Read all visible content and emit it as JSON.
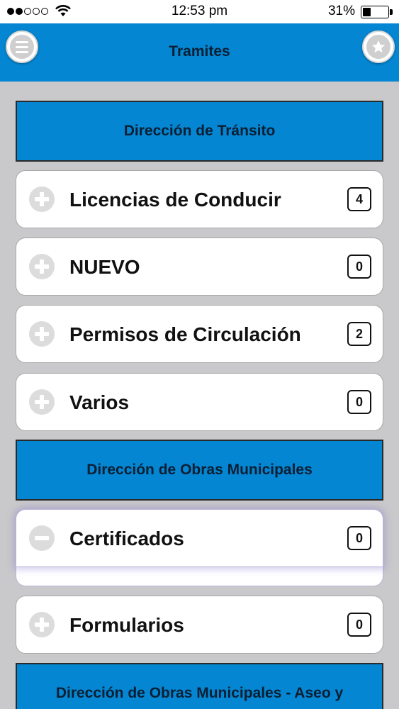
{
  "status_bar": {
    "time": "12:53 pm",
    "battery": "31%",
    "battery_level": 0.31,
    "signal_dots_filled": 2,
    "signal_dots_total": 5
  },
  "nav": {
    "title": "Tramites",
    "menu_icon": "hamburger-menu-icon",
    "favorite_icon": "star-icon"
  },
  "colors": {
    "accent": "#0586d2",
    "background": "#c9c9cb",
    "card": "#ffffff"
  },
  "sections": [
    {
      "title": "Dirección de Tránsito",
      "items": [
        {
          "label": "Licencias de Conducir",
          "count": "4",
          "state": "collapsed",
          "icon": "plus-icon"
        },
        {
          "label": "NUEVO",
          "count": "0",
          "state": "collapsed",
          "icon": "plus-icon"
        },
        {
          "label": "Permisos de Circulación",
          "count": "2",
          "state": "collapsed",
          "icon": "plus-icon"
        },
        {
          "label": "Varios",
          "count": "0",
          "state": "collapsed",
          "icon": "plus-icon"
        }
      ]
    },
    {
      "title": "Dirección de Obras Municipales",
      "items": [
        {
          "label": "Certificados",
          "count": "0",
          "state": "expanded",
          "icon": "minus-icon"
        },
        {
          "label": "Formularios",
          "count": "0",
          "state": "collapsed",
          "icon": "plus-icon"
        }
      ]
    },
    {
      "title": "Dirección de Obras Municipales - Aseo y",
      "items": []
    }
  ]
}
